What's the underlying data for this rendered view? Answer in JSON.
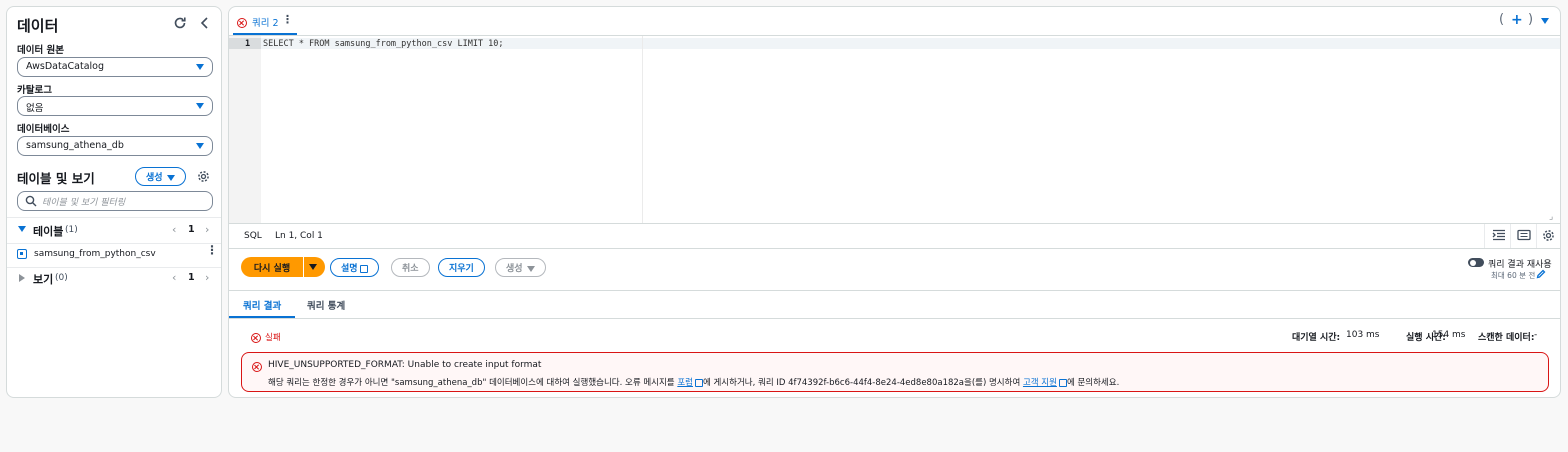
{
  "left": {
    "title": "데이터",
    "data_source_label": "데이터 원본",
    "data_source_value": "AwsDataCatalog",
    "catalog_label": "카탈로그",
    "catalog_value": "없음",
    "database_label": "데이터베이스",
    "database_value": "samsung_athena_db",
    "tables_views_title": "테이블 및 보기",
    "create_label": "생성",
    "filter_placeholder": "테이블 및 보기 필터링",
    "tables_label": "테이블",
    "tables_count": "(1)",
    "tables_page": "1",
    "table_item": "samsung_from_python_csv",
    "views_label": "보기",
    "views_count": "(0)",
    "views_page": "1"
  },
  "editor": {
    "tab_label": "쿼리 2",
    "line_number": "1",
    "sql": "SELECT * FROM samsung_from_python_csv LIMIT 10;",
    "language": "SQL",
    "cursor_pos": "Ln 1, Col 1",
    "add_tab": "+"
  },
  "actions": {
    "run_again": "다시 실행",
    "explain": "설명",
    "cancel": "취소",
    "clear": "지우기",
    "create": "생성",
    "reuse_label": "쿼리 결과 재사용",
    "reuse_sub": "최대 60 분 전"
  },
  "results": {
    "tab_results": "쿼리 결과",
    "tab_stats": "쿼리 통계",
    "status": "실패",
    "queue_label": "대기열 시간:",
    "queue_value": "103 ms",
    "run_label": "실행 시간:",
    "run_value": "154 ms",
    "scanned_label": "스캔한 데이터:",
    "scanned_value": "-",
    "error_title": "HIVE_UNSUPPORTED_FORMAT: Unable to create input format",
    "error_part1": "해당 쿼리는 한정한 경우가 아니면 \"samsung_athena_db\" 데이터베이스에 대하여 실행했습니다. 오류 메시지를 ",
    "error_link1": "포럼",
    "error_part2": "에 게시하거나, 쿼리 ID 4f74392f-b6c6-44f4-8e24-4ed8e80a182a을(를) 명시하여 ",
    "error_link2": "고객 지원",
    "error_part3": "에 문의하세요."
  },
  "colors": {
    "accent": "#0972d3",
    "run_button": "#ff9900",
    "error": "#d91515",
    "error_bg": "#fff7f7"
  }
}
